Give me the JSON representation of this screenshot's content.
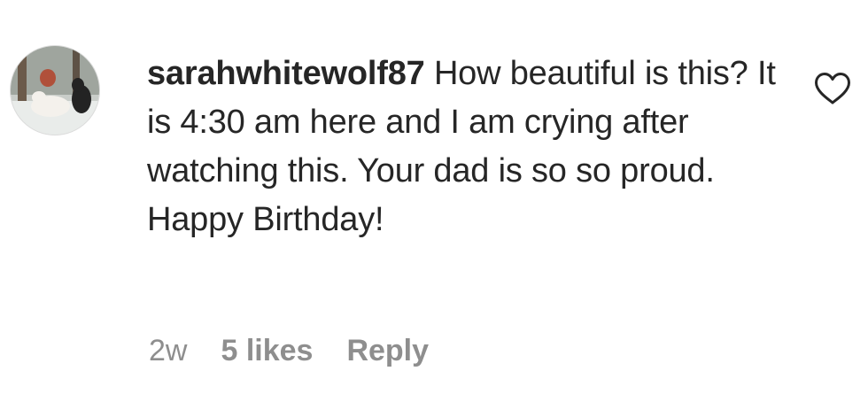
{
  "comment": {
    "username": "sarahwhitewolf87",
    "text": "How beautiful is this? It is 4:30 am here and I am crying after watching this. Your dad is so so proud. Happy Birthday!",
    "time": "2w",
    "likes": "5 likes",
    "reply_label": "Reply"
  },
  "icons": {
    "like": "heart-outline-icon",
    "avatar": "user-avatar-photo"
  },
  "colors": {
    "text_primary": "#262626",
    "text_secondary": "#8e8e8e",
    "background": "#ffffff"
  }
}
